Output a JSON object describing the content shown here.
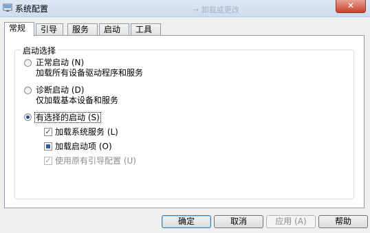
{
  "window": {
    "title": "系统配置",
    "title_background_blur": "→ 卸载或更改"
  },
  "tabs": [
    {
      "label": "常规",
      "active": true
    },
    {
      "label": "引导",
      "active": false
    },
    {
      "label": "服务",
      "active": false
    },
    {
      "label": "启动",
      "active": false
    },
    {
      "label": "工具",
      "active": false
    }
  ],
  "startup": {
    "group_label": "启动选择",
    "normal": {
      "label": "正常启动 (N)",
      "desc": "加载所有设备驱动程序和服务",
      "selected": false
    },
    "diagnostic": {
      "label": "诊断启动 (D)",
      "desc": "仅加载基本设备和服务",
      "selected": false
    },
    "selective": {
      "label": "有选择的启动 (S)",
      "selected": true
    },
    "options": [
      {
        "label": "加载系统服务 (L)",
        "state": "checked"
      },
      {
        "label": "加载启动项 (O)",
        "state": "indeterminate"
      },
      {
        "label": "使用原有引导配置 (U)",
        "state": "checked-disabled"
      }
    ]
  },
  "buttons": {
    "ok": "确定",
    "cancel": "取消",
    "apply": "应用 (A)",
    "help": "帮助"
  },
  "icons": {
    "window_icon": "system-config-icon",
    "close_glyph": "✕",
    "check_glyph": "✓"
  }
}
